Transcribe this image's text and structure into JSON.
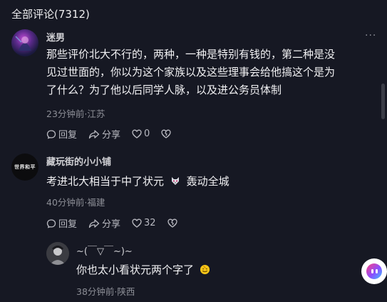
{
  "header": {
    "title": "全部评论(7312)"
  },
  "comments": [
    {
      "username": "迷男",
      "text_lines": [
        "那些评价北大不行的，两种，一种是特别有钱的，第二种是没",
        "见过世面的，你以为这个家族以及这些理事会给他搞这个是为",
        "了什么？为了他以后同学人脉，以及进公务员体制"
      ],
      "meta": "23分钟前·江苏",
      "reply_label": "回复",
      "share_label": "分享",
      "like_count": "0",
      "more_label": "···"
    },
    {
      "username": "藏玩街的小小铺",
      "avatar_text": "世界和平",
      "text": "考进北大相当于中了状元",
      "text_tail": "轰动全城",
      "meta": "40分钟前·福建",
      "reply_label": "回复",
      "share_label": "分享",
      "like_count": "32"
    }
  ],
  "reply": {
    "username": "~(￣▽￣~)~",
    "text": "你也太小看状元两个字了",
    "meta": "38分钟前·陕西"
  }
}
